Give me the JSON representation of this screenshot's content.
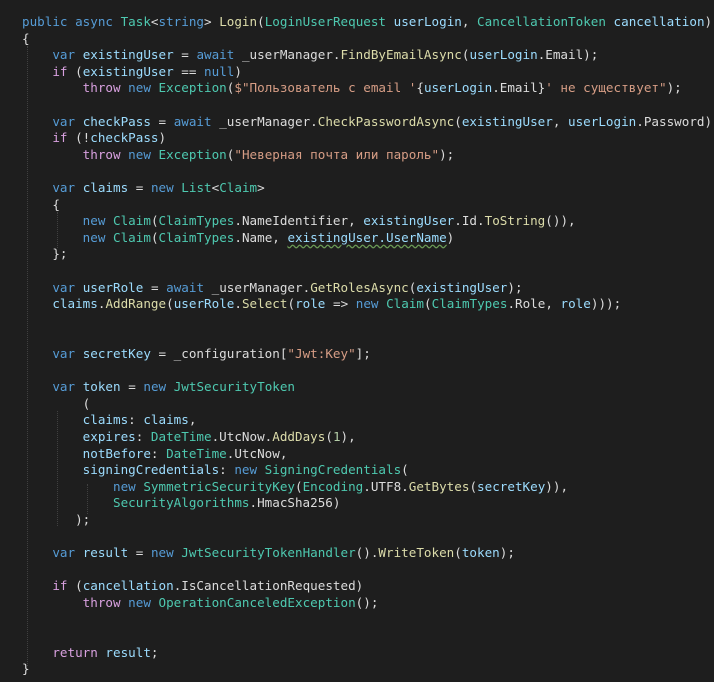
{
  "theme": {
    "background": "#1e1e1e",
    "keyword": "#569cd6",
    "control_flow": "#d8a0df",
    "type": "#4ec9b0",
    "method": "#dcdcaa",
    "parameter": "#9cdcfe",
    "string": "#d69d85",
    "number": "#b5cea8",
    "plain": "#dcdcdc"
  },
  "lines": [
    [
      {
        "t": "public ",
        "k": "kw"
      },
      {
        "t": "async ",
        "k": "kw"
      },
      {
        "t": "Task",
        "k": "type"
      },
      {
        "t": "<",
        "k": "plain"
      },
      {
        "t": "string",
        "k": "kw"
      },
      {
        "t": "> ",
        "k": "plain"
      },
      {
        "t": "Login",
        "k": "method"
      },
      {
        "t": "(",
        "k": "plain"
      },
      {
        "t": "LoginUserRequest",
        "k": "type"
      },
      {
        "t": " ",
        "k": "plain"
      },
      {
        "t": "userLogin",
        "k": "param"
      },
      {
        "t": ", ",
        "k": "plain"
      },
      {
        "t": "CancellationToken",
        "k": "type"
      },
      {
        "t": " ",
        "k": "plain"
      },
      {
        "t": "cancellation",
        "k": "param"
      },
      {
        "t": ")",
        "k": "plain"
      }
    ],
    [
      {
        "t": "{",
        "k": "plain"
      }
    ],
    [
      {
        "t": "    "
      },
      {
        "t": "var ",
        "k": "kw"
      },
      {
        "t": "existingUser",
        "k": "param"
      },
      {
        "t": " = ",
        "k": "plain"
      },
      {
        "t": "await ",
        "k": "kw"
      },
      {
        "t": "_userManager.",
        "k": "plain"
      },
      {
        "t": "FindByEmailAsync",
        "k": "method"
      },
      {
        "t": "(",
        "k": "plain"
      },
      {
        "t": "userLogin",
        "k": "param"
      },
      {
        "t": ".Email);",
        "k": "plain"
      }
    ],
    [
      {
        "t": "    "
      },
      {
        "t": "if",
        "k": "flow"
      },
      {
        "t": " (",
        "k": "plain"
      },
      {
        "t": "existingUser",
        "k": "param"
      },
      {
        "t": " == ",
        "k": "plain"
      },
      {
        "t": "null",
        "k": "kw"
      },
      {
        "t": ")",
        "k": "plain"
      }
    ],
    [
      {
        "t": "        "
      },
      {
        "t": "throw ",
        "k": "flow"
      },
      {
        "t": "new ",
        "k": "kw"
      },
      {
        "t": "Exception",
        "k": "type"
      },
      {
        "t": "(",
        "k": "plain"
      },
      {
        "t": "$\"Пользователь с email '",
        "k": "str"
      },
      {
        "t": "{",
        "k": "plain"
      },
      {
        "t": "userLogin",
        "k": "param"
      },
      {
        "t": ".Email}",
        "k": "plain"
      },
      {
        "t": "' не существует\"",
        "k": "str"
      },
      {
        "t": ");",
        "k": "plain"
      }
    ],
    [],
    [
      {
        "t": "    "
      },
      {
        "t": "var ",
        "k": "kw"
      },
      {
        "t": "checkPass",
        "k": "param"
      },
      {
        "t": " = ",
        "k": "plain"
      },
      {
        "t": "await ",
        "k": "kw"
      },
      {
        "t": "_userManager.",
        "k": "plain"
      },
      {
        "t": "CheckPasswordAsync",
        "k": "method"
      },
      {
        "t": "(",
        "k": "plain"
      },
      {
        "t": "existingUser",
        "k": "param"
      },
      {
        "t": ", ",
        "k": "plain"
      },
      {
        "t": "userLogin",
        "k": "param"
      },
      {
        "t": ".Password);",
        "k": "plain"
      }
    ],
    [
      {
        "t": "    "
      },
      {
        "t": "if",
        "k": "flow"
      },
      {
        "t": " (!",
        "k": "plain"
      },
      {
        "t": "checkPass",
        "k": "param"
      },
      {
        "t": ")",
        "k": "plain"
      }
    ],
    [
      {
        "t": "        "
      },
      {
        "t": "throw ",
        "k": "flow"
      },
      {
        "t": "new ",
        "k": "kw"
      },
      {
        "t": "Exception",
        "k": "type"
      },
      {
        "t": "(",
        "k": "plain"
      },
      {
        "t": "\"Неверная почта или пароль\"",
        "k": "str"
      },
      {
        "t": ");",
        "k": "plain"
      }
    ],
    [],
    [
      {
        "t": "    "
      },
      {
        "t": "var ",
        "k": "kw"
      },
      {
        "t": "claims",
        "k": "param"
      },
      {
        "t": " = ",
        "k": "plain"
      },
      {
        "t": "new ",
        "k": "kw"
      },
      {
        "t": "List",
        "k": "type"
      },
      {
        "t": "<",
        "k": "plain"
      },
      {
        "t": "Claim",
        "k": "type"
      },
      {
        "t": ">",
        "k": "plain"
      }
    ],
    [
      {
        "t": "    "
      },
      {
        "t": "{",
        "k": "plain"
      }
    ],
    [
      {
        "t": "        "
      },
      {
        "t": "new ",
        "k": "kw"
      },
      {
        "t": "Claim",
        "k": "type"
      },
      {
        "t": "(",
        "k": "plain"
      },
      {
        "t": "ClaimTypes",
        "k": "type"
      },
      {
        "t": ".NameIdentifier, ",
        "k": "plain"
      },
      {
        "t": "existingUser",
        "k": "param"
      },
      {
        "t": ".Id.",
        "k": "plain"
      },
      {
        "t": "ToString",
        "k": "method"
      },
      {
        "t": "()),",
        "k": "plain"
      }
    ],
    [
      {
        "t": "        "
      },
      {
        "t": "new ",
        "k": "kw"
      },
      {
        "t": "Claim",
        "k": "type"
      },
      {
        "t": "(",
        "k": "plain"
      },
      {
        "t": "ClaimTypes",
        "k": "type"
      },
      {
        "t": ".Name, ",
        "k": "plain"
      },
      {
        "t": "existingUser.UserName",
        "k": "param",
        "sq": true
      },
      {
        "t": ")",
        "k": "plain"
      }
    ],
    [
      {
        "t": "    "
      },
      {
        "t": "};",
        "k": "plain"
      }
    ],
    [],
    [
      {
        "t": "    "
      },
      {
        "t": "var ",
        "k": "kw"
      },
      {
        "t": "userRole",
        "k": "param"
      },
      {
        "t": " = ",
        "k": "plain"
      },
      {
        "t": "await ",
        "k": "kw"
      },
      {
        "t": "_userManager.",
        "k": "plain"
      },
      {
        "t": "GetRolesAsync",
        "k": "method"
      },
      {
        "t": "(",
        "k": "plain"
      },
      {
        "t": "existingUser",
        "k": "param"
      },
      {
        "t": ");",
        "k": "plain"
      }
    ],
    [
      {
        "t": "    "
      },
      {
        "t": "claims",
        "k": "param"
      },
      {
        "t": ".",
        "k": "plain"
      },
      {
        "t": "AddRange",
        "k": "method"
      },
      {
        "t": "(",
        "k": "plain"
      },
      {
        "t": "userRole",
        "k": "param"
      },
      {
        "t": ".",
        "k": "plain"
      },
      {
        "t": "Select",
        "k": "method"
      },
      {
        "t": "(",
        "k": "plain"
      },
      {
        "t": "role",
        "k": "param"
      },
      {
        "t": " => ",
        "k": "plain"
      },
      {
        "t": "new ",
        "k": "kw"
      },
      {
        "t": "Claim",
        "k": "type"
      },
      {
        "t": "(",
        "k": "plain"
      },
      {
        "t": "ClaimTypes",
        "k": "type"
      },
      {
        "t": ".Role, ",
        "k": "plain"
      },
      {
        "t": "role",
        "k": "param"
      },
      {
        "t": ")));",
        "k": "plain"
      }
    ],
    [],
    [],
    [
      {
        "t": "    "
      },
      {
        "t": "var ",
        "k": "kw"
      },
      {
        "t": "secretKey",
        "k": "param"
      },
      {
        "t": " = _configuration[",
        "k": "plain"
      },
      {
        "t": "\"Jwt:Key\"",
        "k": "str"
      },
      {
        "t": "];",
        "k": "plain"
      }
    ],
    [],
    [
      {
        "t": "    "
      },
      {
        "t": "var ",
        "k": "kw"
      },
      {
        "t": "token",
        "k": "param"
      },
      {
        "t": " = ",
        "k": "plain"
      },
      {
        "t": "new ",
        "k": "kw"
      },
      {
        "t": "JwtSecurityToken",
        "k": "type"
      }
    ],
    [
      {
        "t": "        "
      },
      {
        "t": "(",
        "k": "plain"
      }
    ],
    [
      {
        "t": "        "
      },
      {
        "t": "claims",
        "k": "param"
      },
      {
        "t": ": ",
        "k": "plain"
      },
      {
        "t": "claims",
        "k": "param"
      },
      {
        "t": ",",
        "k": "plain"
      }
    ],
    [
      {
        "t": "        "
      },
      {
        "t": "expires",
        "k": "param"
      },
      {
        "t": ": ",
        "k": "plain"
      },
      {
        "t": "DateTime",
        "k": "type"
      },
      {
        "t": ".UtcNow.",
        "k": "plain"
      },
      {
        "t": "AddDays",
        "k": "method"
      },
      {
        "t": "(",
        "k": "plain"
      },
      {
        "t": "1",
        "k": "num"
      },
      {
        "t": "),",
        "k": "plain"
      }
    ],
    [
      {
        "t": "        "
      },
      {
        "t": "notBefore",
        "k": "param"
      },
      {
        "t": ": ",
        "k": "plain"
      },
      {
        "t": "DateTime",
        "k": "type"
      },
      {
        "t": ".UtcNow,",
        "k": "plain"
      }
    ],
    [
      {
        "t": "        "
      },
      {
        "t": "signingCredentials",
        "k": "param"
      },
      {
        "t": ": ",
        "k": "plain"
      },
      {
        "t": "new ",
        "k": "kw"
      },
      {
        "t": "SigningCredentials",
        "k": "type"
      },
      {
        "t": "(",
        "k": "plain"
      }
    ],
    [
      {
        "t": "            "
      },
      {
        "t": "new ",
        "k": "kw"
      },
      {
        "t": "SymmetricSecurityKey",
        "k": "type"
      },
      {
        "t": "(",
        "k": "plain"
      },
      {
        "t": "Encoding",
        "k": "type"
      },
      {
        "t": ".UTF8.",
        "k": "plain"
      },
      {
        "t": "GetBytes",
        "k": "method"
      },
      {
        "t": "(",
        "k": "plain"
      },
      {
        "t": "secretKey",
        "k": "param"
      },
      {
        "t": ")),",
        "k": "plain"
      }
    ],
    [
      {
        "t": "            "
      },
      {
        "t": "SecurityAlgorithms",
        "k": "type"
      },
      {
        "t": ".HmacSha256)",
        "k": "plain"
      }
    ],
    [
      {
        "t": "       "
      },
      {
        "t": ");",
        "k": "plain"
      }
    ],
    [],
    [
      {
        "t": "    "
      },
      {
        "t": "var ",
        "k": "kw"
      },
      {
        "t": "result",
        "k": "param"
      },
      {
        "t": " = ",
        "k": "plain"
      },
      {
        "t": "new ",
        "k": "kw"
      },
      {
        "t": "JwtSecurityTokenHandler",
        "k": "type"
      },
      {
        "t": "().",
        "k": "plain"
      },
      {
        "t": "WriteToken",
        "k": "method"
      },
      {
        "t": "(",
        "k": "plain"
      },
      {
        "t": "token",
        "k": "param"
      },
      {
        "t": ");",
        "k": "plain"
      }
    ],
    [],
    [
      {
        "t": "    "
      },
      {
        "t": "if",
        "k": "flow"
      },
      {
        "t": " (",
        "k": "plain"
      },
      {
        "t": "cancellation",
        "k": "param"
      },
      {
        "t": ".IsCancellationRequested)",
        "k": "plain"
      }
    ],
    [
      {
        "t": "        "
      },
      {
        "t": "throw ",
        "k": "flow"
      },
      {
        "t": "new ",
        "k": "kw"
      },
      {
        "t": "OperationCanceledException",
        "k": "type"
      },
      {
        "t": "();",
        "k": "plain"
      }
    ],
    [],
    [],
    [
      {
        "t": "    "
      },
      {
        "t": "return ",
        "k": "flow"
      },
      {
        "t": "result",
        "k": "param"
      },
      {
        "t": ";",
        "k": "plain"
      }
    ],
    [
      {
        "t": "}",
        "k": "plain"
      }
    ]
  ]
}
